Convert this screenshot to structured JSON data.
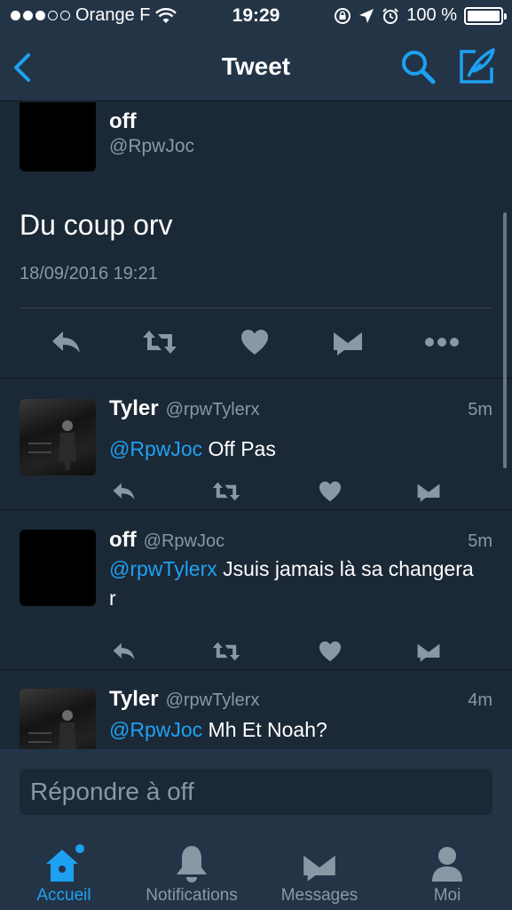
{
  "status_bar": {
    "carrier": "Orange F",
    "time": "19:29",
    "battery": "100 %"
  },
  "nav": {
    "title": "Tweet"
  },
  "main_tweet": {
    "name": "off",
    "handle": "@RpwJoc",
    "text": "Du coup orv",
    "date": "18/09/2016 19:21"
  },
  "replies": [
    {
      "name": "Tyler",
      "handle": "@rpwTylerx",
      "time": "5m",
      "mention": "@RpwJoc",
      "text": " Off Pas"
    },
    {
      "name": "off",
      "handle": "@RpwJoc",
      "time": "5m",
      "mention": "@rpwTylerx",
      "text": " Jsuis jamais là sa changera r"
    },
    {
      "name": "Tyler",
      "handle": "@rpwTylerx",
      "time": "4m",
      "mention": "@RpwJoc",
      "text": " Mh Et Noah?"
    }
  ],
  "reply_bar": {
    "placeholder": "Répondre à off"
  },
  "tabs": [
    {
      "label": "Accueil",
      "icon": "home-icon",
      "active": true
    },
    {
      "label": "Notifications",
      "icon": "bell-icon",
      "active": false
    },
    {
      "label": "Messages",
      "icon": "envelope-icon",
      "active": false
    },
    {
      "label": "Moi",
      "icon": "person-icon",
      "active": false
    }
  ],
  "colors": {
    "accent": "#1da1f2",
    "background": "#1b2836",
    "bar": "#243447",
    "secondary_text": "#8899a6"
  }
}
